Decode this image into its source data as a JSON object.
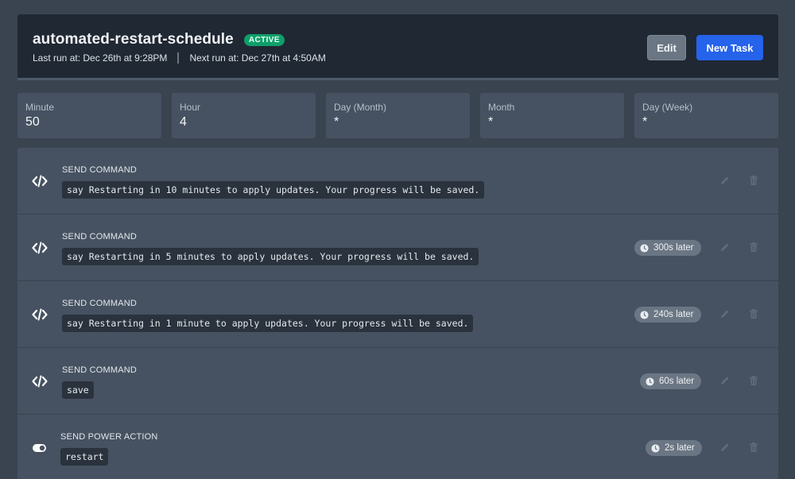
{
  "schedule": {
    "name": "automated-restart-schedule",
    "status": "ACTIVE",
    "last_run": "Last run at: Dec 26th at 9:28PM",
    "next_run": "Next run at: Dec 27th at 4:50AM"
  },
  "buttons": {
    "edit": "Edit",
    "new_task": "New Task"
  },
  "cron": [
    {
      "label": "Minute",
      "value": "50"
    },
    {
      "label": "Hour",
      "value": "4"
    },
    {
      "label": "Day (Month)",
      "value": "*"
    },
    {
      "label": "Month",
      "value": "*"
    },
    {
      "label": "Day (Week)",
      "value": "*"
    }
  ],
  "tasks": [
    {
      "type": "SEND COMMAND",
      "icon": "code-icon",
      "payload": "say Restarting in 10 minutes to apply updates. Your progress will be saved.",
      "delay": ""
    },
    {
      "type": "SEND COMMAND",
      "icon": "code-icon",
      "payload": "say Restarting in 5 minutes to apply updates. Your progress will be saved.",
      "delay": "300s later"
    },
    {
      "type": "SEND COMMAND",
      "icon": "code-icon",
      "payload": "say Restarting in 1 minute to apply updates. Your progress will be saved.",
      "delay": "240s later"
    },
    {
      "type": "SEND COMMAND",
      "icon": "code-icon",
      "payload": "save",
      "delay": "60s later"
    },
    {
      "type": "SEND POWER ACTION",
      "icon": "toggle-icon",
      "payload": "restart",
      "delay": "2s later"
    }
  ],
  "colors": {
    "background": "#3a4451",
    "header": "#202833",
    "panel": "#465261",
    "active": "#0f9f6a",
    "primary": "#2563eb"
  }
}
